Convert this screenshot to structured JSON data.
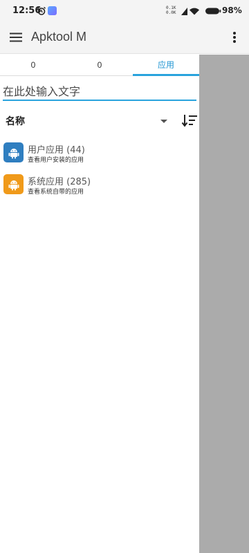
{
  "status_bar": {
    "time": "12:56",
    "net_speed_up": "0.1K",
    "net_speed_down": "0.0K",
    "battery": "98%"
  },
  "app_bar": {
    "title": "Apktool M"
  },
  "tabs": [
    {
      "label": "0",
      "active": false
    },
    {
      "label": "0",
      "active": false
    },
    {
      "label": "应用",
      "active": true
    }
  ],
  "search": {
    "placeholder": "在此处输入文字"
  },
  "sort": {
    "label": "名称"
  },
  "items": [
    {
      "title": "用户应用 (44)",
      "subtitle": "查看用户安装的应用",
      "icon": "android-icon",
      "color": "#2f7ec0"
    },
    {
      "title": "系统应用 (285)",
      "subtitle": "查看系统自带的应用",
      "icon": "android-icon",
      "color": "#f09a1a"
    }
  ],
  "colors": {
    "accent": "#29a3dd",
    "scrim": "#ababab"
  }
}
